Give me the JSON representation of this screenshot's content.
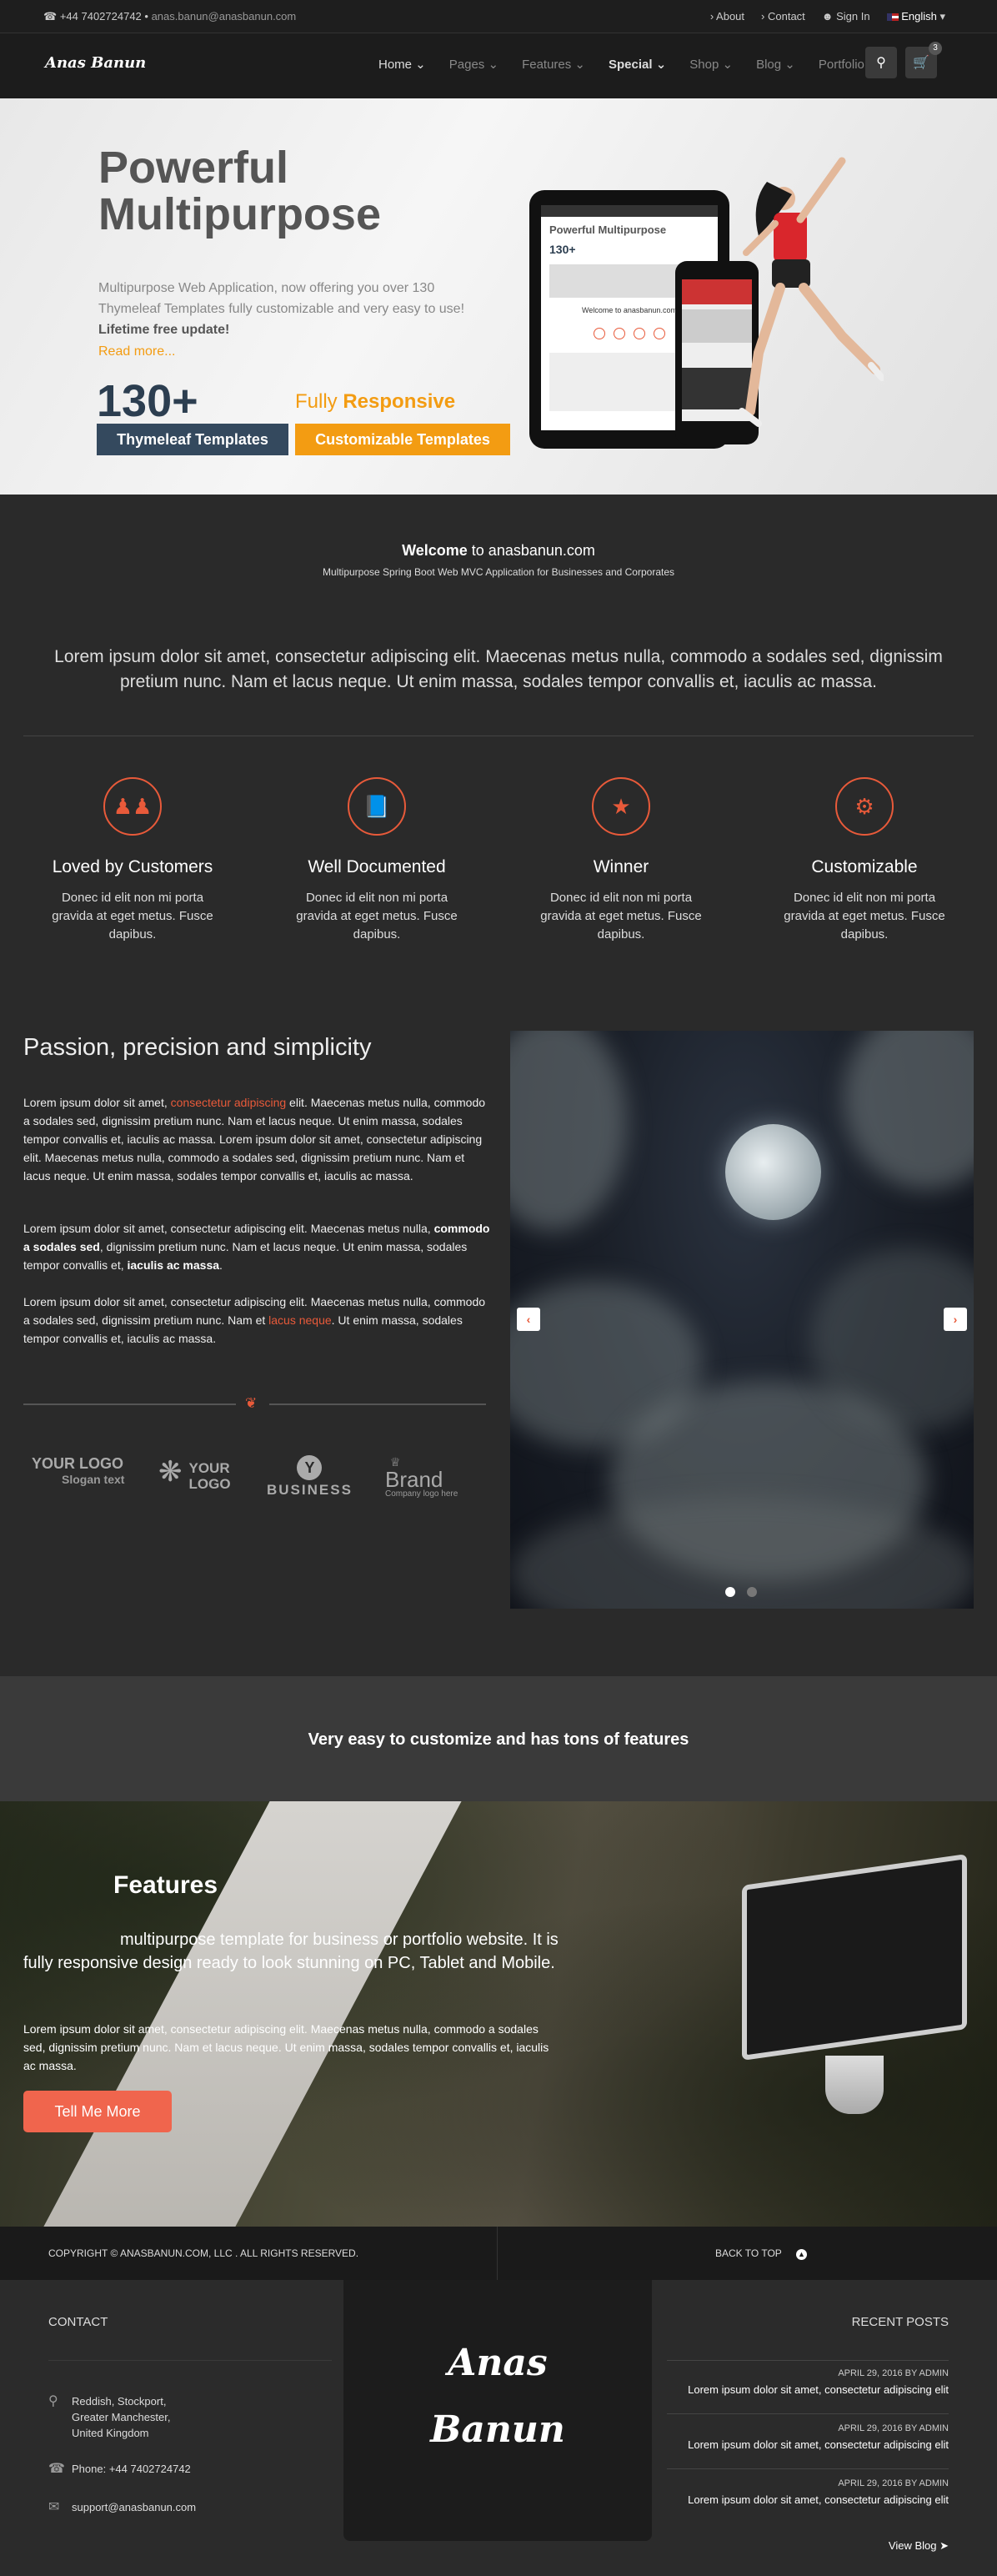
{
  "topbar": {
    "phone": "+44 7402724742",
    "email": "anas.banun@anasbanun.com",
    "links": [
      "About",
      "Contact",
      "Sign In",
      "English"
    ]
  },
  "nav": {
    "logo": "Anas Banun",
    "items": [
      "Home",
      "Pages",
      "Features",
      "Special",
      "Shop",
      "Blog",
      "Portfolio"
    ],
    "cart_count": "3"
  },
  "hero": {
    "title_line1": "Powerful",
    "title_line2": "Multipurpose",
    "desc": "Multipurpose Web Application, now offering you over 130 Thymeleaf Templates fully customizable and very easy to use!",
    "desc_bold": "Lifetime free update!",
    "read_more": "Read more...",
    "number": "130+",
    "btn1": "Thymeleaf Templates",
    "fully": "Fully",
    "responsive": "Responsive",
    "btn2": "Customizable Templates",
    "tablet_title": "Powerful Multipurpose",
    "tablet_num": "130+",
    "tablet_welcome": "Welcome to anasbanun.com"
  },
  "welcome": {
    "bold": "Welcome",
    "rest": "to anasbanun.com",
    "subtitle": "Multipurpose Spring Boot Web MVC Application for Businesses and Corporates"
  },
  "lorem_center": "Lorem ipsum dolor sit amet, consectetur adipiscing elit. Maecenas metus nulla, commodo a sodales sed, dignissim pretium nunc. Nam et lacus neque. Ut enim massa, sodales tempor convallis et, iaculis ac massa.",
  "features_row": [
    {
      "title": "Loved by Customers",
      "desc": "Donec id elit non mi porta gravida at eget metus. Fusce dapibus.",
      "icon": "users-icon"
    },
    {
      "title": "Well Documented",
      "desc": "Donec id elit non mi porta gravida at eget metus. Fusce dapibus.",
      "icon": "book-icon"
    },
    {
      "title": "Winner",
      "desc": "Donec id elit non mi porta gravida at eget metus. Fusce dapibus.",
      "icon": "trophy-icon"
    },
    {
      "title": "Customizable",
      "desc": "Donec id elit non mi porta gravida at eget metus. Fusce dapibus.",
      "icon": "gears-icon"
    }
  ],
  "passion": {
    "title": "Passion, precision and simplicity",
    "p1_a": "Lorem ipsum dolor sit amet, ",
    "p1_link": "consectetur adipiscing",
    "p1_b": " elit. Maecenas metus nulla, commodo a sodales sed, dignissim pretium nunc. Nam et lacus neque. Ut enim massa, sodales tempor convallis et, iaculis ac massa. Lorem ipsum dolor sit amet, consectetur adipiscing elit. Maecenas metus nulla, commodo a sodales sed, dignissim pretium nunc. Nam et lacus neque. Ut enim massa, sodales tempor convallis et, iaculis ac massa.",
    "p2_a": "Lorem ipsum dolor sit amet, consectetur adipiscing elit. Maecenas metus nulla, ",
    "p2_bold1": "commodo a sodales sed",
    "p2_b": ", dignissim pretium nunc. Nam et lacus neque. Ut enim massa, sodales tempor convallis et, ",
    "p2_bold2": "iaculis ac massa",
    "p2_c": ".",
    "p3_a": "Lorem ipsum dolor sit amet, consectetur adipiscing elit. Maecenas metus nulla, commodo a sodales sed, dignissim pretium nunc. Nam et ",
    "p3_link": "lacus neque",
    "p3_b": ". Ut enim massa, sodales tempor convallis et, iaculis ac massa."
  },
  "logos": {
    "l1_top": "YOUR LOGO",
    "l1_bot": "Slogan text",
    "l2_top": "YOUR",
    "l2_bot": "LOGO",
    "l3": "BUSINESS",
    "l4_top": "Brand",
    "l4_bot": "Company logo here"
  },
  "band": "Very easy to customize and has tons of features",
  "features_section": {
    "title": "Features",
    "p1": "multipurpose template for business or portfolio website. It is fully responsive design ready to look stunning on PC, Tablet and Mobile.",
    "p2": "Lorem ipsum dolor sit amet, consectetur adipiscing elit. Maecenas metus nulla, commodo a sodales sed, dignissim pretium nunc. Nam et lacus neque. Ut enim massa, sodales tempor convallis et, iaculis ac massa.",
    "button": "Tell Me More"
  },
  "footbar": {
    "copyright": "COPYRIGHT © ANASBANUN.COM, LLC . ALL RIGHTS RESERVED.",
    "back_to_top": "BACK TO TOP"
  },
  "footer": {
    "contact_heading": "CONTACT",
    "address_1": "Reddish, Stockport,",
    "address_2": "Greater Manchester,",
    "address_3": "United Kingdom",
    "phone": "Phone: +44 7402724742",
    "email": "support@anasbanun.com",
    "logo_line1": "Anas",
    "logo_line2": "Banun",
    "recent_heading": "RECENT POSTS",
    "posts": [
      {
        "date": "APRIL 29, 2016 BY ADMIN",
        "title": "Lorem ipsum dolor sit amet, consectetur adipiscing elit"
      },
      {
        "date": "APRIL 29, 2016 BY ADMIN",
        "title": "Lorem ipsum dolor sit amet, consectetur adipiscing elit"
      },
      {
        "date": "APRIL 29, 2016 BY ADMIN",
        "title": "Lorem ipsum dolor sit amet, consectetur adipiscing elit"
      }
    ],
    "view_blog": "View Blog"
  },
  "colors": {
    "accent": "#e85a3a",
    "orange": "#f39c12",
    "navy": "#34495e"
  }
}
